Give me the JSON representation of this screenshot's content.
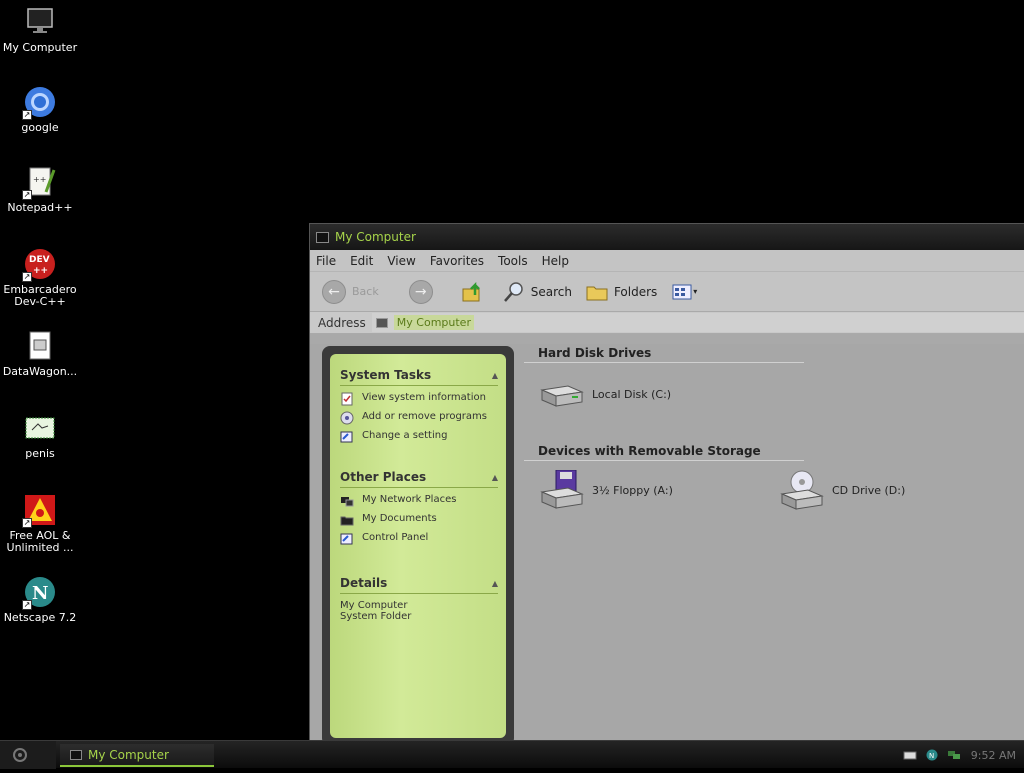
{
  "desktop": {
    "icons": [
      {
        "label": "My Computer",
        "icon": "computer-icon"
      },
      {
        "label": "google",
        "icon": "chrome-icon"
      },
      {
        "label": "Notepad++",
        "icon": "notepad-icon"
      },
      {
        "label": "Embarcadero Dev-C++",
        "icon": "devcpp-icon"
      },
      {
        "label": "DataWagon...",
        "icon": "document-icon"
      },
      {
        "label": "penis",
        "icon": "image-file-icon"
      },
      {
        "label": "Free AOL & Unlimited ...",
        "icon": "aol-icon"
      },
      {
        "label": "Netscape 7.2",
        "icon": "netscape-icon"
      }
    ]
  },
  "window": {
    "title": "My Computer",
    "menu": [
      "File",
      "Edit",
      "View",
      "Favorites",
      "Tools",
      "Help"
    ],
    "toolbar": {
      "back": "Back",
      "search": "Search",
      "folders": "Folders"
    },
    "address": {
      "label": "Address",
      "value": "My Computer"
    },
    "taskpane": {
      "system_tasks": {
        "title": "System Tasks",
        "items": [
          "View system information",
          "Add or remove programs",
          "Change a setting"
        ]
      },
      "other_places": {
        "title": "Other Places",
        "items": [
          "My Network Places",
          "My Documents",
          "Control Panel"
        ]
      },
      "details": {
        "title": "Details",
        "name": "My Computer",
        "type": "System Folder"
      }
    },
    "groups": {
      "hard_disk": {
        "title": "Hard Disk Drives",
        "drives": [
          {
            "label": "Local Disk (C:)"
          }
        ]
      },
      "removable": {
        "title": "Devices with Removable Storage",
        "drives": [
          {
            "label": "3½ Floppy (A:)"
          },
          {
            "label": "CD Drive (D:)"
          }
        ]
      }
    }
  },
  "taskbar": {
    "active_task": "My Computer",
    "clock": "9:52 AM"
  }
}
